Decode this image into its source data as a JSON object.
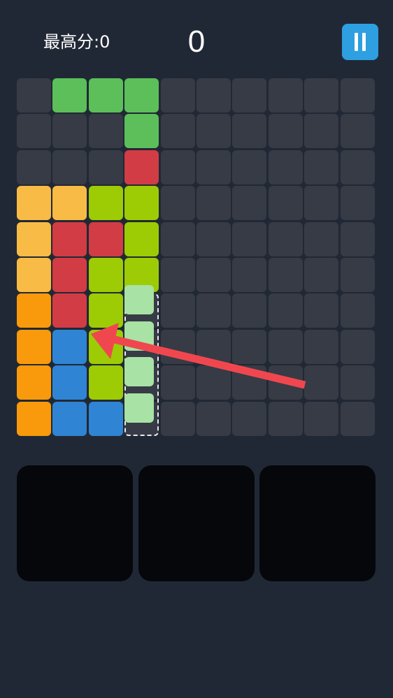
{
  "header": {
    "best_score_label": "最高分:0",
    "current_score": "0",
    "pause_icon": "pause-icon"
  },
  "colors": {
    "background": "#212835",
    "empty": "#373b45",
    "green": "#5cbf5a",
    "red": "#d13c45",
    "yellow": "#f8bb45",
    "lime": "#9dcc04",
    "orange": "#f89a0b",
    "blue": "#2f84d3",
    "ghost": "#a8e2a5",
    "pause_button": "#2e9fe0"
  },
  "board": {
    "rows": 10,
    "cols": 10,
    "grid": [
      [
        "E",
        "G",
        "G",
        "G",
        "E",
        "E",
        "E",
        "E",
        "E",
        "E"
      ],
      [
        "E",
        "E",
        "E",
        "G",
        "E",
        "E",
        "E",
        "E",
        "E",
        "E"
      ],
      [
        "E",
        "E",
        "E",
        "R",
        "E",
        "E",
        "E",
        "E",
        "E",
        "E"
      ],
      [
        "Y",
        "Y",
        "L",
        "L",
        "E",
        "E",
        "E",
        "E",
        "E",
        "E"
      ],
      [
        "Y",
        "R",
        "R",
        "L",
        "E",
        "E",
        "E",
        "E",
        "E",
        "E"
      ],
      [
        "Y",
        "R",
        "L",
        "L",
        "E",
        "E",
        "E",
        "E",
        "E",
        "E"
      ],
      [
        "O",
        "R",
        "L",
        "E",
        "E",
        "E",
        "E",
        "E",
        "E",
        "E"
      ],
      [
        "O",
        "B",
        "L",
        "E",
        "E",
        "E",
        "E",
        "E",
        "E",
        "E"
      ],
      [
        "O",
        "B",
        "L",
        "E",
        "E",
        "E",
        "E",
        "E",
        "E",
        "E"
      ],
      [
        "O",
        "B",
        "B",
        "E",
        "E",
        "E",
        "E",
        "E",
        "E",
        "E"
      ]
    ],
    "ghost_column": 3,
    "ghost_rows": [
      6,
      7,
      8,
      9
    ]
  },
  "hint_arrow": {
    "direction": "left",
    "icon": "drag-hint-arrow-icon"
  },
  "trays": [
    {
      "name": "piece-tray-1"
    },
    {
      "name": "piece-tray-2"
    },
    {
      "name": "piece-tray-3"
    }
  ]
}
